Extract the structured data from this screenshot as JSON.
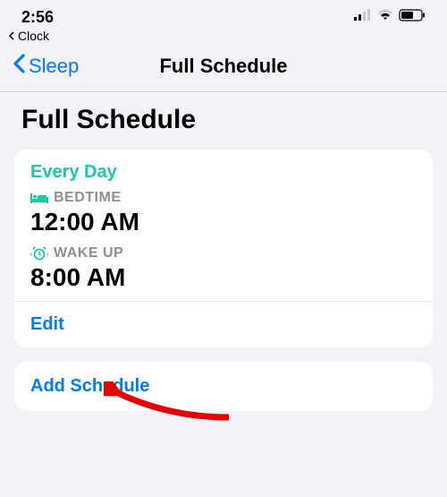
{
  "statusBar": {
    "time": "2:56",
    "breadcrumb": "Clock"
  },
  "nav": {
    "back": "Sleep",
    "title": "Full Schedule"
  },
  "page": {
    "title": "Full Schedule"
  },
  "schedule": {
    "frequency": "Every Day",
    "bedtimeLabel": "BEDTIME",
    "bedtimeValue": "12:00 AM",
    "wakeupLabel": "WAKE UP",
    "wakeupValue": "8:00 AM",
    "editLabel": "Edit"
  },
  "actions": {
    "addSchedule": "Add Schedule"
  }
}
